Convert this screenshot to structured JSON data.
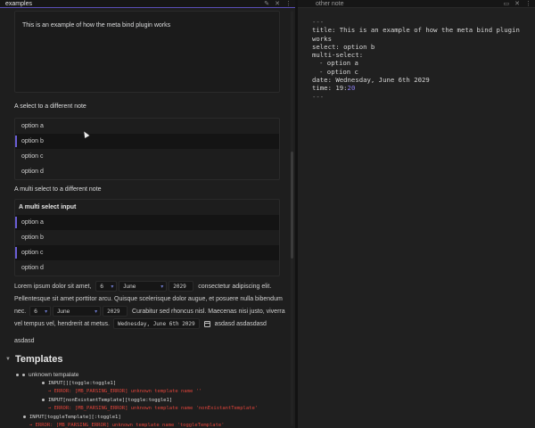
{
  "left_pane": {
    "tab_title": "examples",
    "tab_icons": [
      "pencil-icon",
      "close-icon",
      "more-icon"
    ],
    "intro_text": "This is an example of how the meta bind plugin works",
    "select_label": "A select to a different note",
    "select_options": [
      {
        "label": "option a",
        "selected": false
      },
      {
        "label": "option b",
        "selected": true
      },
      {
        "label": "option c",
        "selected": false
      },
      {
        "label": "option d",
        "selected": false
      }
    ],
    "multi_label": "A multi select to a different note",
    "multi_title": "A multi select input",
    "multi_options": [
      {
        "label": "option a",
        "selected": true
      },
      {
        "label": "option b",
        "selected": false
      },
      {
        "label": "option c",
        "selected": true
      },
      {
        "label": "option d",
        "selected": false
      }
    ],
    "paragraph": {
      "line1_pre": "Lorem ipsum dolor sit amet,",
      "day": "6",
      "month": "June",
      "year": "2029",
      "line1_post": "consectetur adipiscing elit.",
      "line2": "Pellentesque sit amet porttitor arcu. Quisque scelerisque dolor augue, et posuere nulla bibendum",
      "line3_pre": "nec.",
      "day2": "6",
      "month2": "June",
      "year2": "2029",
      "line3_post": "Curabitur sed rhoncus nisl. Maecenas nisi justo, viverra",
      "line4_pre": "vel tempus vel, hendrerit at metus.",
      "date_value": "Wednesday, June 6th 2029",
      "line4_post": "asdasd asdasdasd",
      "line5": "asdasd"
    },
    "templates": {
      "heading": "Templates",
      "unknown_label": "unknown tempalate",
      "item1_code": "INPUT[][toggle:toggle1]",
      "item1_err": "→ ERROR: [MB_PARSING_ERROR] unknown template name ''",
      "item2_code": "INPUT[nonExistantTemplate][toggle:toggle1]",
      "item2_err": "→ ERROR: [MB_PARSING_ERROR] unknown template name 'nonExistantTemplate'",
      "item3_code": "INPUT[toggleTemplate][:toggle1]",
      "item3_err": "→ ERROR: [MB_PARSING_ERROR] unknown template name 'toggleTemplate'"
    }
  },
  "right_pane": {
    "tab_title": "other note",
    "tab_icons": [
      "book-icon",
      "close-icon",
      "more-icon"
    ],
    "yaml": {
      "open": "---",
      "title_line1": "title: This is an example of how the meta bind plugin",
      "title_line2": "works",
      "select": "select: option b",
      "multi": "multi-select:",
      "multi_a": "option a",
      "multi_c": "option c",
      "date": "date: Wednesday, June 6th 2029",
      "time_key": "time: 19:",
      "time_min": "20",
      "close": "---"
    }
  },
  "colors": {
    "background": "#1e1e1e",
    "accent": "#6a5ed6",
    "error": "#e0443a"
  }
}
